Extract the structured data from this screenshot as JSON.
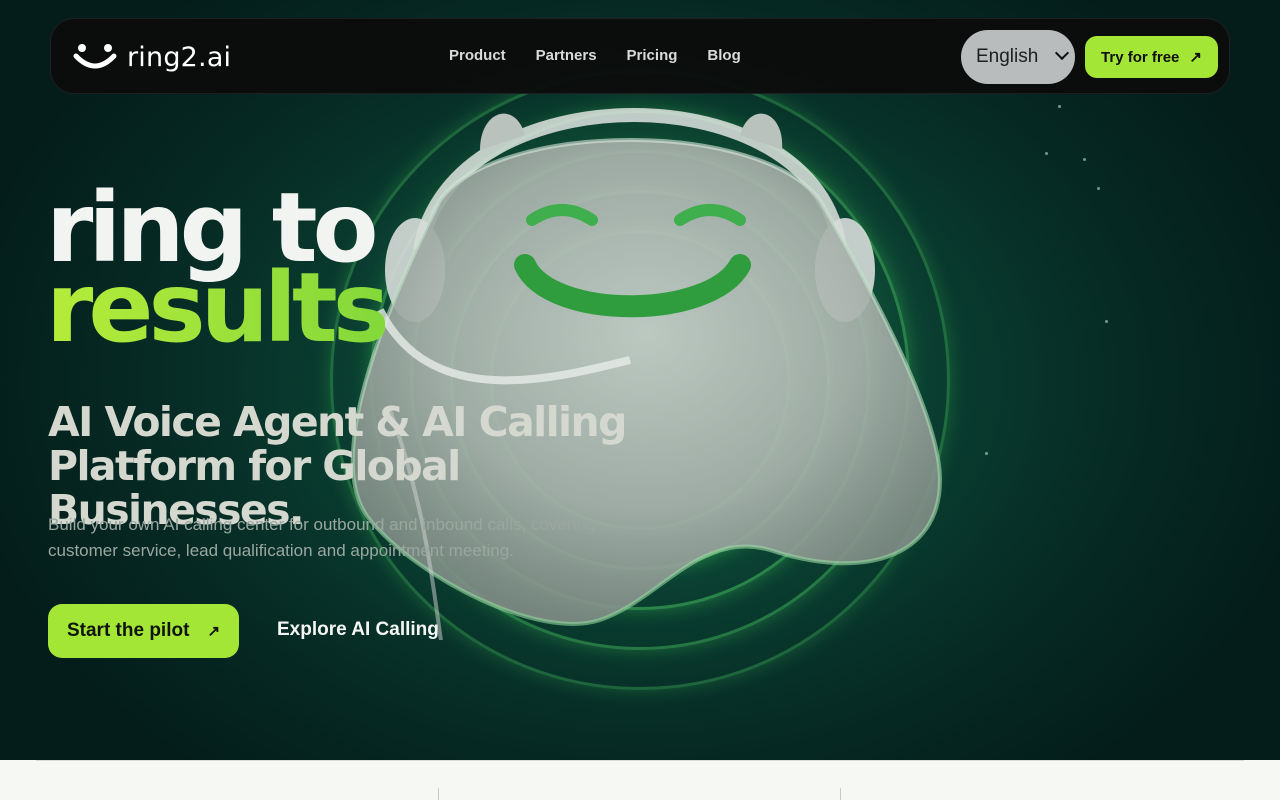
{
  "brand": {
    "name": "ring2.ai",
    "accent": "#a4e635"
  },
  "nav": {
    "items": [
      "Product",
      "Partners",
      "Pricing",
      "Blog"
    ]
  },
  "language": {
    "selected": "English"
  },
  "header_cta": {
    "label": "Try for free",
    "icon": "arrow-up-right-icon"
  },
  "hero": {
    "title_line1": "ring to",
    "title_line2": "results",
    "subtitle": "AI Voice Agent & AI Calling Platform for Global Businesses.",
    "description": "Build your own AI calling center for outbound and inbound calls, covering customer service, lead qualification and appointment meeting.",
    "primary_cta": "Start the pilot",
    "secondary_cta": "Explore AI Calling"
  },
  "colors": {
    "background_dark": "#062a24",
    "glow_green": "#5aeb6e",
    "bottom_bg": "#f6f8f4"
  }
}
